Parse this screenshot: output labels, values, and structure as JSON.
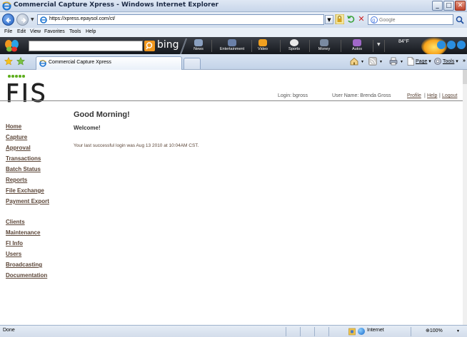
{
  "window": {
    "title": "Commercial Capture Xpress - Windows Internet Explorer",
    "buttons": {
      "minimize": "_",
      "maximize": "□",
      "close": "✕"
    }
  },
  "addressbar": {
    "url": "https://xpress.epaysol.com/ct/",
    "search_placeholder": "Google"
  },
  "menubar": {
    "items": [
      "File",
      "Edit",
      "View",
      "Favorites",
      "Tools",
      "Help"
    ]
  },
  "bing_toolbar": {
    "logo_text": "bing",
    "items": [
      "News",
      "Entertainment",
      "Video",
      "Sports",
      "Money",
      "Autos"
    ],
    "weather": "84°F"
  },
  "tabbar": {
    "tab_label": "Commercial Capture Xpress",
    "commands": {
      "page": "Page",
      "tools": "Tools"
    }
  },
  "header": {
    "login_label": "Login: bgross",
    "user_label": "User Name: Brenda Gross",
    "links": {
      "profile": "Profile",
      "help": "Help",
      "logout": "Logout"
    },
    "separator": "|"
  },
  "main": {
    "greeting": "Good Morning!",
    "welcome": "Welcome!",
    "last_login": "Your last successful login was Aug 13 2010 at 10:04AM CST."
  },
  "nav": {
    "group1": [
      "Home",
      "Capture",
      "Approval",
      "Transactions",
      "Batch Status",
      "Reports",
      "File Exchange",
      "Payment Export"
    ],
    "group2": [
      "Clients",
      "Maintenance",
      "FI Info",
      "Users",
      "Broadcasting",
      "Documentation"
    ]
  },
  "statusbar": {
    "status": "Done",
    "zone": "Internet",
    "zoom": "100%"
  },
  "colors": {
    "link": "#5c4638",
    "fis_green": "#5fae1e"
  }
}
